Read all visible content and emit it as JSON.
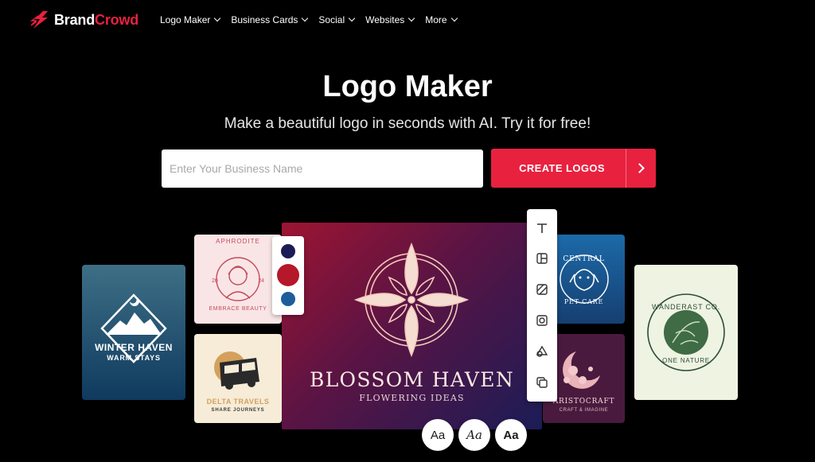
{
  "brand": {
    "part1": "Brand",
    "part2": "Crowd",
    "accent": "#e8213f"
  },
  "nav": {
    "items": [
      {
        "label": "Logo Maker"
      },
      {
        "label": "Business Cards"
      },
      {
        "label": "Social"
      },
      {
        "label": "Websites"
      },
      {
        "label": "More"
      }
    ]
  },
  "hero": {
    "title": "Logo Maker",
    "subtitle": "Make a beautiful logo in seconds with AI. Try it for free!",
    "input_placeholder": "Enter Your Business Name",
    "cta_label": "CREATE LOGOS"
  },
  "cards": {
    "winter": {
      "name": "WINTER HAVEN",
      "tagline": "WARM STAYS"
    },
    "aphrodite": {
      "name": "APHRODITE",
      "num_left": "20",
      "num_right": "24",
      "tagline": "EMBRACE BEAUTY"
    },
    "delta": {
      "name": "DELTA TRAVELS",
      "tagline": "SHARE JOURNEYS"
    },
    "main": {
      "name": "BLOSSOM HAVEN",
      "tagline": "FLOWERING IDEAS"
    },
    "pet": {
      "top": "CENTRAL",
      "bottom": "PET CARE"
    },
    "aristo": {
      "name": "ARISTOCRAFT",
      "tagline": "CRAFT & IMAGINE"
    },
    "wander": {
      "top": "WANDERAST CO.",
      "bottom": "ONE NATURE"
    }
  },
  "palette": {
    "colors": [
      "#1a1c55",
      "#b5172b",
      "#1f5c9c"
    ]
  },
  "toolbar": {
    "icons": [
      "text-icon",
      "layout-icon",
      "background-icon",
      "frame-icon",
      "shapes-icon",
      "duplicate-icon"
    ]
  },
  "font_styles": {
    "regular": "Aa",
    "italic": "Aa",
    "bold": "Aa"
  }
}
